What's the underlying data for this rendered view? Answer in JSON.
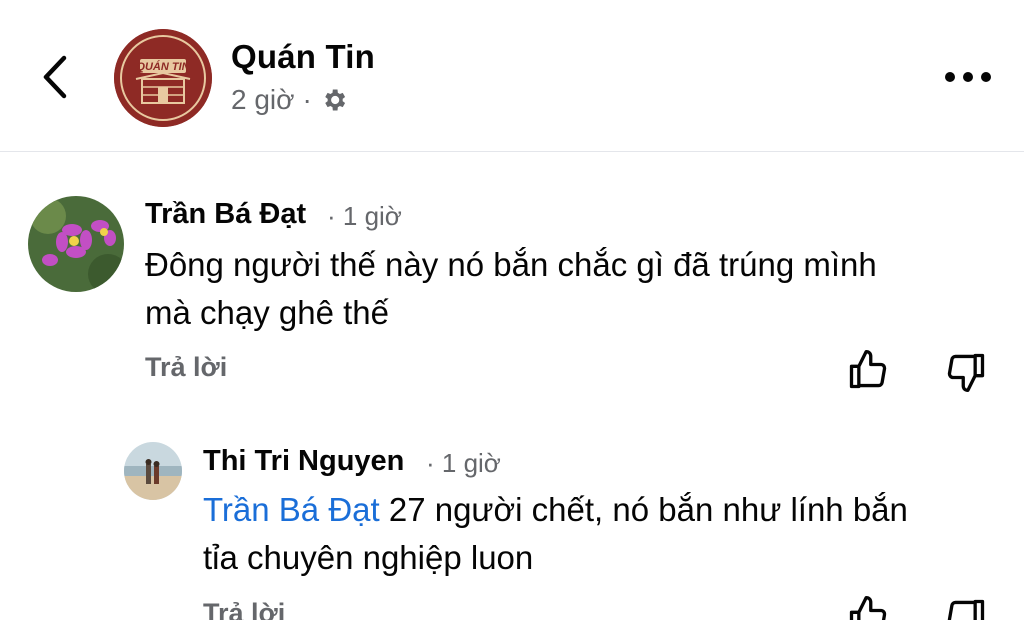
{
  "header": {
    "title": "Quán Tin",
    "time": "2 giờ",
    "separator": "·",
    "logo_text": "QUÁN TIN",
    "icons": {
      "back": "chevron-left-icon",
      "privacy": "gear-icon",
      "more": "more-horizontal-icon"
    }
  },
  "comments": [
    {
      "author": "Trần Bá Đạt",
      "time": "· 1 giờ",
      "text_line1": "Đông người thế này nó bắn chắc gì đã trúng mình",
      "text_line2": "mà chạy ghê thế",
      "reply_label": "Trả lời"
    },
    {
      "author": "Thi Tri Nguyen",
      "time": "· 1 giờ",
      "mention": "Trần Bá Đạt",
      "text_line1": " 27 người chết, nó bắn như lính bắn",
      "text_line2": "tỉa chuyên nghiệp luon",
      "reply_label": "Trả lời"
    }
  ],
  "colors": {
    "brand_logo": "#8e2a25",
    "mention": "#1a6ed8",
    "secondary_text": "#65676b"
  }
}
